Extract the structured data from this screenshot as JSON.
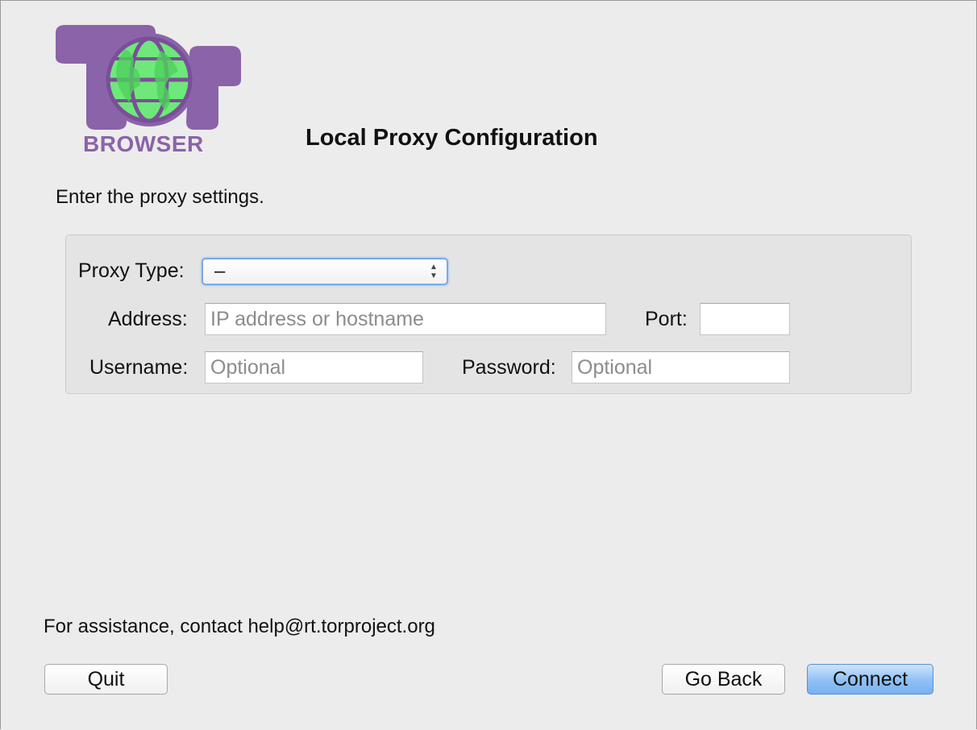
{
  "logo": {
    "caption": "BROWSER",
    "purple": "#8b63a8",
    "green": "#6ee87a"
  },
  "page_title": "Local Proxy Configuration",
  "instruction": "Enter the proxy settings.",
  "form": {
    "proxy_type_label": "Proxy Type:",
    "proxy_type_value": "–",
    "address_label": "Address:",
    "address_placeholder": "IP address or hostname",
    "port_label": "Port:",
    "port_value": "",
    "username_label": "Username:",
    "username_placeholder": "Optional",
    "password_label": "Password:",
    "password_placeholder": "Optional"
  },
  "assistance_text": "For assistance, contact help@rt.torproject.org",
  "buttons": {
    "quit": "Quit",
    "go_back": "Go Back",
    "connect": "Connect"
  },
  "colors": {
    "primary_button": "#8fc0f5",
    "focus_ring": "#7aa9e6"
  }
}
